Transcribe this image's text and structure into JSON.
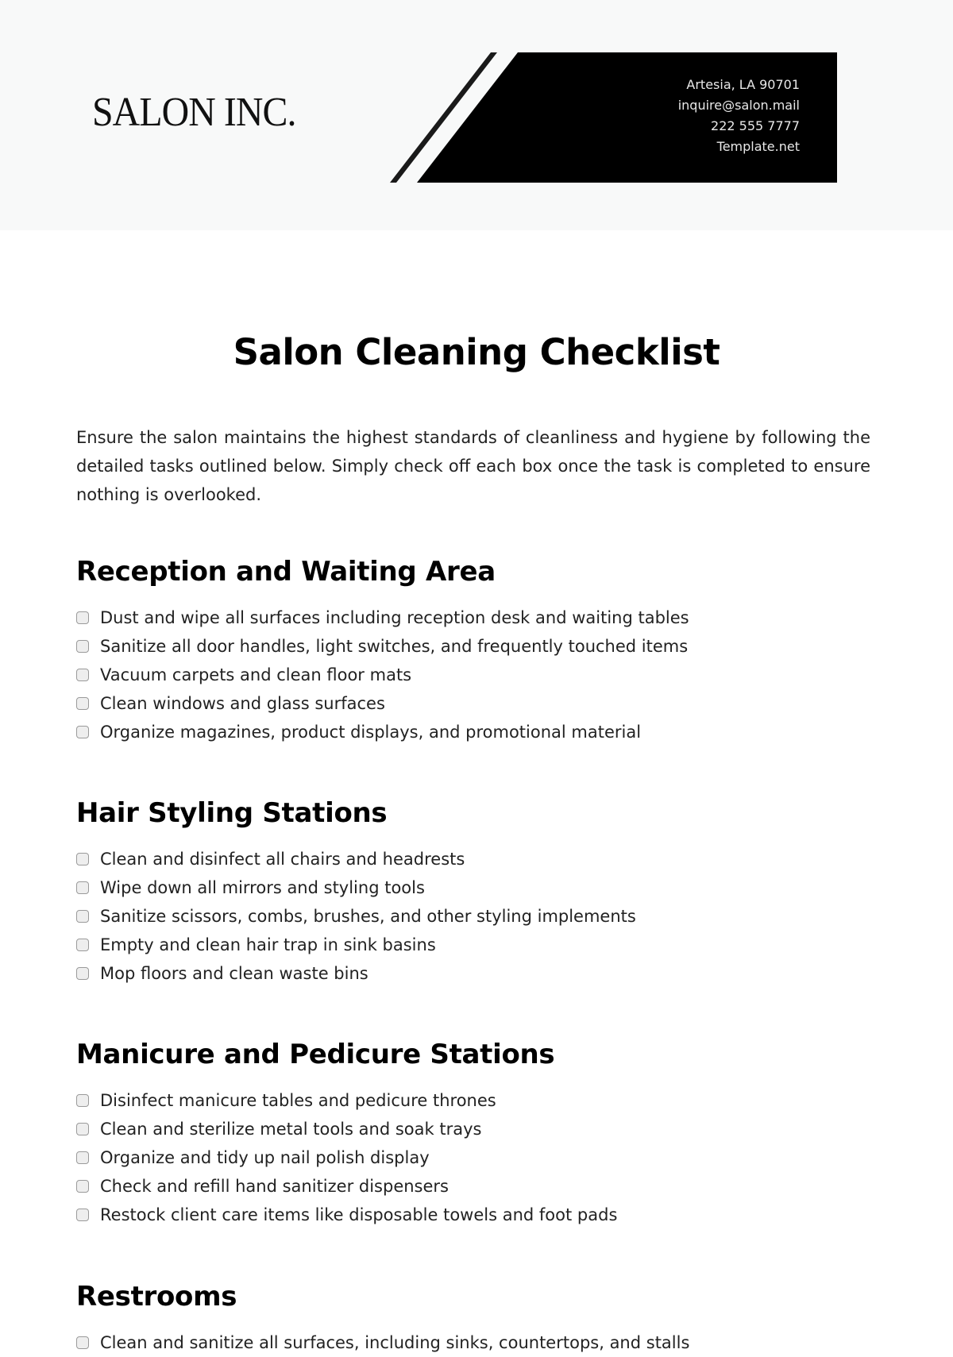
{
  "header": {
    "company_name": "SALON INC.",
    "contact": {
      "address": "Artesia, LA 90701",
      "email": "inquire@salon.mail",
      "phone": "222 555 7777",
      "website": "Template.net"
    },
    "colors": {
      "background": "#f8f9f9",
      "banner": "#000000",
      "contact_text": "#e8e8e8"
    }
  },
  "document": {
    "title": "Salon Cleaning Checklist",
    "intro": "Ensure the salon maintains the highest standards of cleanliness and hygiene by following the detailed tasks outlined below. Simply check off each box once the task is completed to ensure nothing is overlooked.",
    "sections": [
      {
        "heading": "Reception and Waiting Area",
        "items": [
          "Dust and wipe all surfaces including reception desk and waiting tables",
          "Sanitize all door handles, light switches, and frequently touched items",
          "Vacuum carpets and clean floor mats",
          "Clean windows and glass surfaces",
          "Organize magazines, product displays, and promotional material"
        ]
      },
      {
        "heading": "Hair Styling Stations",
        "items": [
          "Clean and disinfect all chairs and headrests",
          "Wipe down all mirrors and styling tools",
          "Sanitize scissors, combs, brushes, and other styling implements",
          "Empty and clean hair trap in sink basins",
          "Mop floors and clean waste bins"
        ]
      },
      {
        "heading": "Manicure and Pedicure Stations",
        "items": [
          "Disinfect manicure tables and pedicure thrones",
          "Clean and sterilize metal tools and soak trays",
          "Organize and tidy up nail polish display",
          "Check and refill hand sanitizer dispensers",
          "Restock client care items like disposable towels and foot pads"
        ]
      },
      {
        "heading": "Restrooms",
        "items": [
          "Clean and sanitize all surfaces, including sinks, countertops, and stalls"
        ]
      }
    ]
  }
}
